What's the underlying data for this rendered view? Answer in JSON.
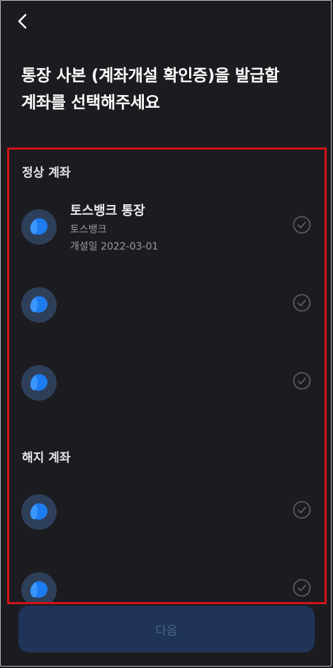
{
  "header": {
    "back_icon": "chevron-left-icon"
  },
  "title": {
    "line1": "통장 사본 (계좌개설 확인증)을 발급할",
    "line2": "계좌를 선택해주세요"
  },
  "sections": {
    "active": {
      "label": "정상 계좌",
      "accounts": [
        {
          "name": "토스뱅크 통장",
          "bank": "토스뱅크",
          "opened": "개설일 2022-03-01"
        },
        {
          "name": "",
          "bank": "",
          "opened": ""
        },
        {
          "name": "",
          "bank": "",
          "opened": ""
        }
      ]
    },
    "closed": {
      "label": "해지 계좌",
      "accounts": [
        {
          "name": "",
          "bank": "",
          "opened": ""
        },
        {
          "name": "",
          "bank": "",
          "opened": ""
        }
      ]
    }
  },
  "footer": {
    "next_label": "다음"
  },
  "colors": {
    "background": "#1c1c20",
    "highlight": "#d1131a",
    "logo_blue": "#1e7cf2",
    "button_disabled": "#1f3458"
  }
}
